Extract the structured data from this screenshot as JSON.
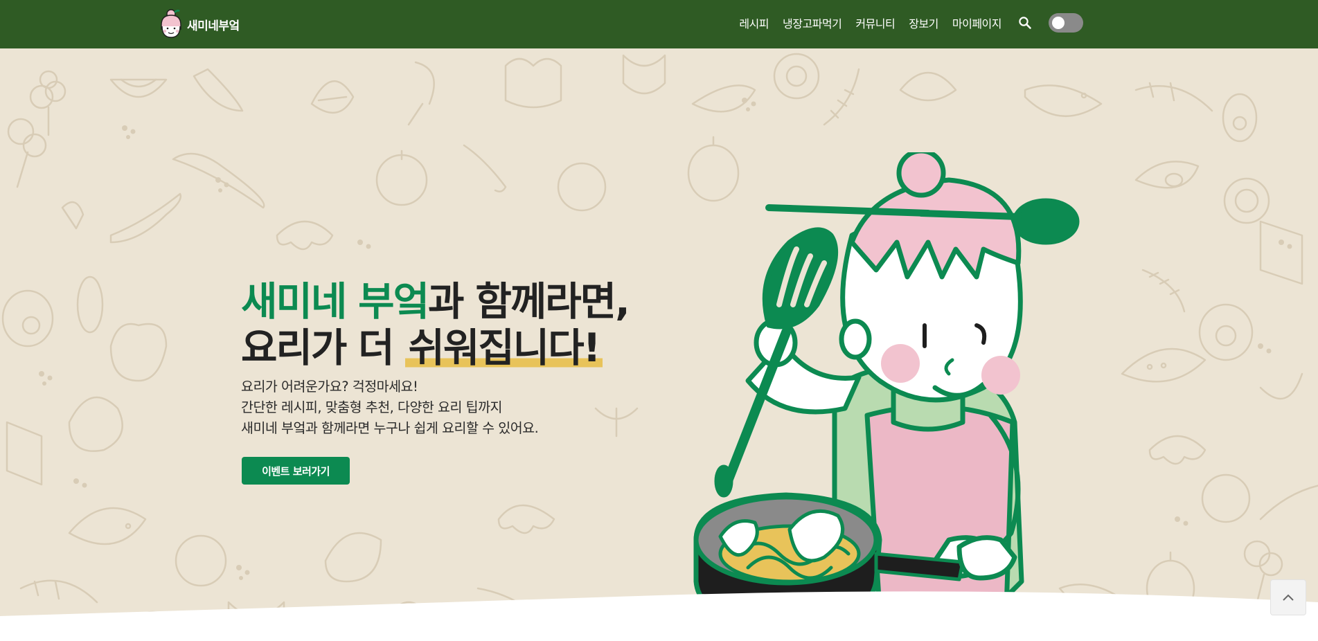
{
  "brand": {
    "name": "새미네부엌",
    "logo_icon": "chef-girl-logo-icon"
  },
  "nav": {
    "items": [
      {
        "label": "레시피"
      },
      {
        "label": "냉장고파먹기"
      },
      {
        "label": "커뮤니티"
      },
      {
        "label": "장보기"
      },
      {
        "label": "마이페이지"
      }
    ],
    "search_icon": "search-icon",
    "theme_toggle": {
      "state": "off"
    }
  },
  "hero": {
    "headline": {
      "line1_brand": "새미네 부엌",
      "line1_rest": "과 함께라면,",
      "line2_start": "요리가 더 ",
      "line2_highlight": "쉬워집니다!"
    },
    "description": [
      "요리가 어려운가요? 걱정마세요!",
      "간단한 레시피, 맞춤형 추천, 다양한 요리 팁까지",
      "새미네 부엌과 함께라면 누구나 쉽게 요리할 수 있어요."
    ],
    "cta_label": "이벤트 보러가기",
    "illustration": "chef-girl-cooking-illustration"
  },
  "scroll_top_icon": "chevron-up-icon",
  "colors": {
    "header_bg": "#2f5b24",
    "brand_green": "#0c8a51",
    "hero_bg": "#ece4d4",
    "highlight": "#e8c35a",
    "apron_pink": "#ecb8c6"
  }
}
